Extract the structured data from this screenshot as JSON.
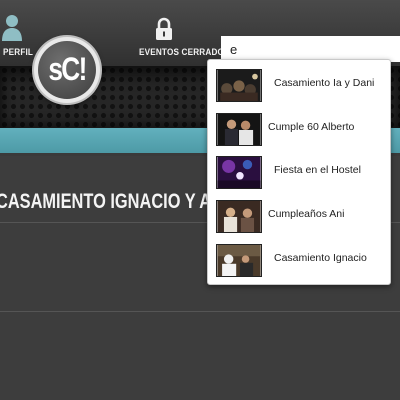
{
  "nav": {
    "profile_label": "PERFIL",
    "events_label": "EVENTOS CERRADOS",
    "profile_icon": "user-icon",
    "events_icon": "lock-icon"
  },
  "logo": {
    "text": "sC!"
  },
  "search": {
    "value": "e",
    "placeholder": ""
  },
  "event": {
    "title": "CASAMIENTO IGNACIO Y ANITA"
  },
  "autocomplete": {
    "results": [
      {
        "label": "Casamiento Ia y Dani"
      },
      {
        "label": "Cumple 60 Alberto"
      },
      {
        "label": "Fiesta en el Hostel"
      },
      {
        "label": "Cumpleaños Ani"
      },
      {
        "label": "Casamiento Ignacio"
      }
    ]
  },
  "colors": {
    "accent_band": "#55a3ae",
    "header": "#3a3a3a",
    "content": "#3d3d3d"
  }
}
